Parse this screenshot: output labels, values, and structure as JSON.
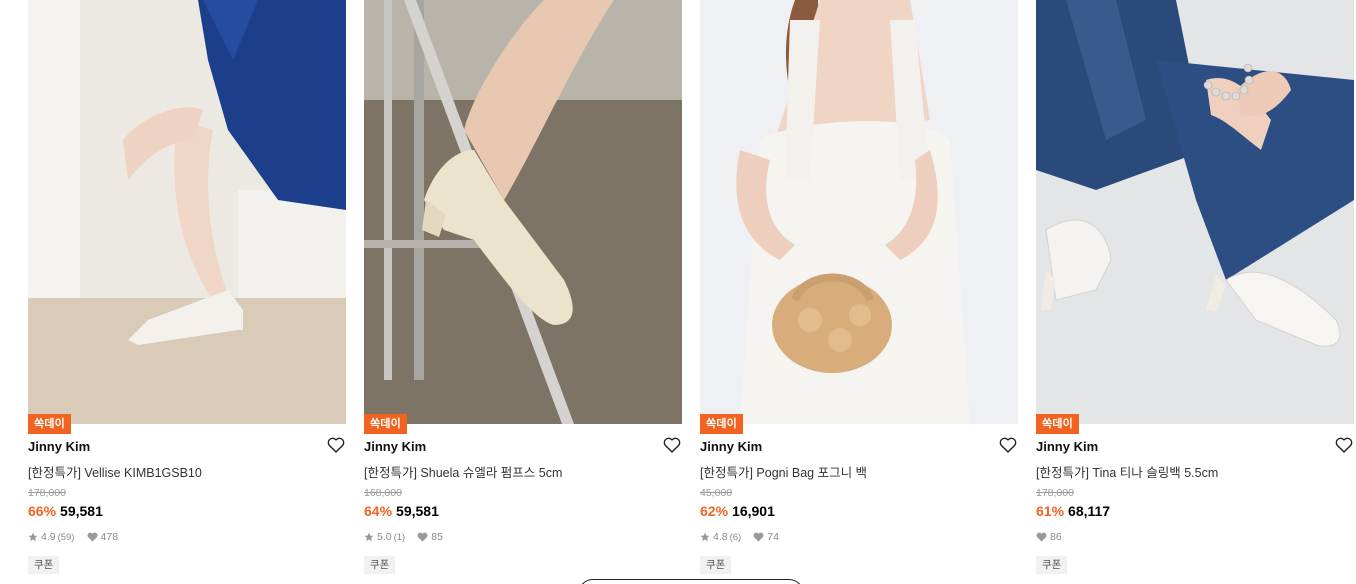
{
  "products": [
    {
      "badge": "쏙데이",
      "brand": "Jinny Kim",
      "name": "[한정특가] Vellise KIMB1GSB10",
      "original_price": "178,000",
      "discount": "66%",
      "price": "59,581",
      "rating": "4.9",
      "review_count": "(59)",
      "likes": "478",
      "coupon": "쿠폰",
      "image_icon": "product-photo-slingback-heels"
    },
    {
      "badge": "쏙데이",
      "brand": "Jinny Kim",
      "name": "[한정특가] Shuela 슈엘라 펌프스 5cm",
      "original_price": "168,000",
      "discount": "64%",
      "price": "59,581",
      "rating": "5.0",
      "review_count": "(1)",
      "likes": "85",
      "coupon": "쿠폰",
      "image_icon": "product-photo-cream-pumps"
    },
    {
      "badge": "쏙데이",
      "brand": "Jinny Kim",
      "name": "[한정특가] Pogni Bag 포그니 백",
      "original_price": "45,000",
      "discount": "62%",
      "price": "16,901",
      "rating": "4.8",
      "review_count": "(6)",
      "likes": "74",
      "coupon": "쿠폰",
      "image_icon": "product-photo-puffy-bag"
    },
    {
      "badge": "쏙데이",
      "brand": "Jinny Kim",
      "name": "[한정특가] Tina 티나 슬링백 5.5cm",
      "original_price": "178,000",
      "discount": "61%",
      "price": "68,117",
      "rating": "",
      "review_count": "",
      "likes": "86",
      "coupon": "쿠폰",
      "image_icon": "product-photo-strap-slingbacks"
    }
  ],
  "colors": {
    "accent": "#f26322",
    "text": "#111111",
    "muted": "#999999"
  }
}
